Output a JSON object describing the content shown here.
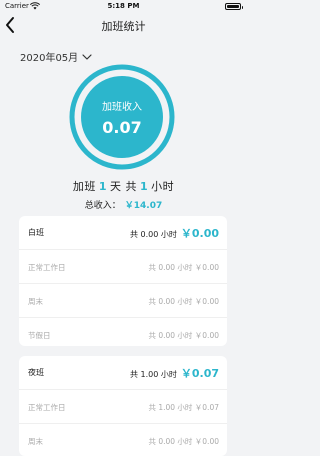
{
  "status_bar": {
    "carrier": "Carrier",
    "time": "5:18 PM"
  },
  "nav": {
    "title": "加班统计",
    "back_icon": "chevron-left-icon"
  },
  "month_picker": {
    "label": "2020年05月",
    "icon": "chevron-down-icon"
  },
  "summary": {
    "ring_label": "加班收入",
    "ring_value": "0.07",
    "ring_progress": 1.0,
    "days_prefix": "加班",
    "days_value": "1",
    "days_unit": "天",
    "total_prefix": "共",
    "hours_value": "1",
    "hours_unit": "小时",
    "income_label": "总收入：",
    "income_value": "￥14.07"
  },
  "colors": {
    "accent": "#2cb6cc",
    "ring_track": "#d6eef3",
    "background": "#f2f3f5"
  },
  "cards": [
    {
      "title": "白班",
      "hours_text": "共 0.00 小时",
      "money": "￥0.00",
      "rows": [
        {
          "label": "正常工作日",
          "value": "共 0.00 小时 ￥0.00"
        },
        {
          "label": "周末",
          "value": "共 0.00 小时 ￥0.00"
        },
        {
          "label": "节假日",
          "value": "共 0.00 小时 ￥0.00"
        }
      ]
    },
    {
      "title": "夜班",
      "hours_text": "共 1.00 小时",
      "money": "￥0.07",
      "rows": [
        {
          "label": "正常工作日",
          "value": "共 1.00 小时 ￥0.07"
        },
        {
          "label": "周末",
          "value": "共 0.00 小时 ￥0.00"
        }
      ]
    }
  ]
}
